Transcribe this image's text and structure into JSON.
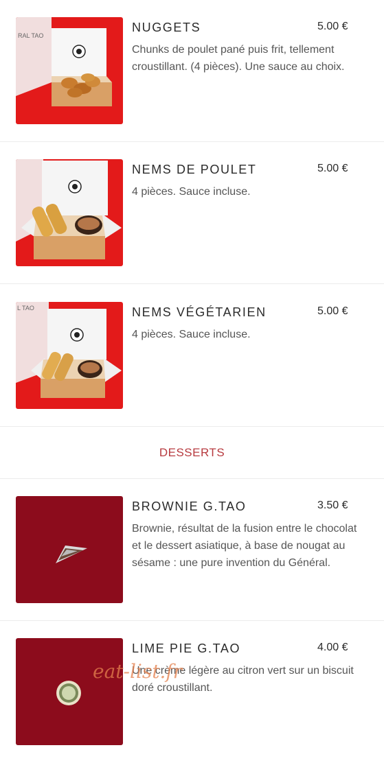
{
  "items": [
    {
      "name": "NUGGETS",
      "price": "5.00 €",
      "desc": "Chunks de poulet pané puis frit, tellement croustillant. (4 pièces). Une sauce au choix."
    },
    {
      "name": "NEMS DE POULET",
      "price": "5.00 €",
      "desc": "4 pièces. Sauce incluse."
    },
    {
      "name": "NEMS VÉGÉTARIEN",
      "price": "5.00 €",
      "desc": "4 pièces. Sauce incluse."
    }
  ],
  "section": {
    "title": "DESSERTS"
  },
  "desserts": [
    {
      "name": "BROWNIE G.TAO",
      "price": "3.50 €",
      "desc": "Brownie, résultat de la fusion entre le chocolat et le dessert asiatique, à base de nougat au sésame : une pure invention du Général."
    },
    {
      "name": "LIME PIE G.TAO",
      "price": "4.00 €",
      "desc": "Une crème légère au citron vert sur un biscuit doré croustillant."
    }
  ],
  "watermark": "eat-list.fr",
  "colors": {
    "accent": "#b73a3f",
    "photo_red": "#e31a1a",
    "dessert_bg": "#8c0c1c"
  }
}
